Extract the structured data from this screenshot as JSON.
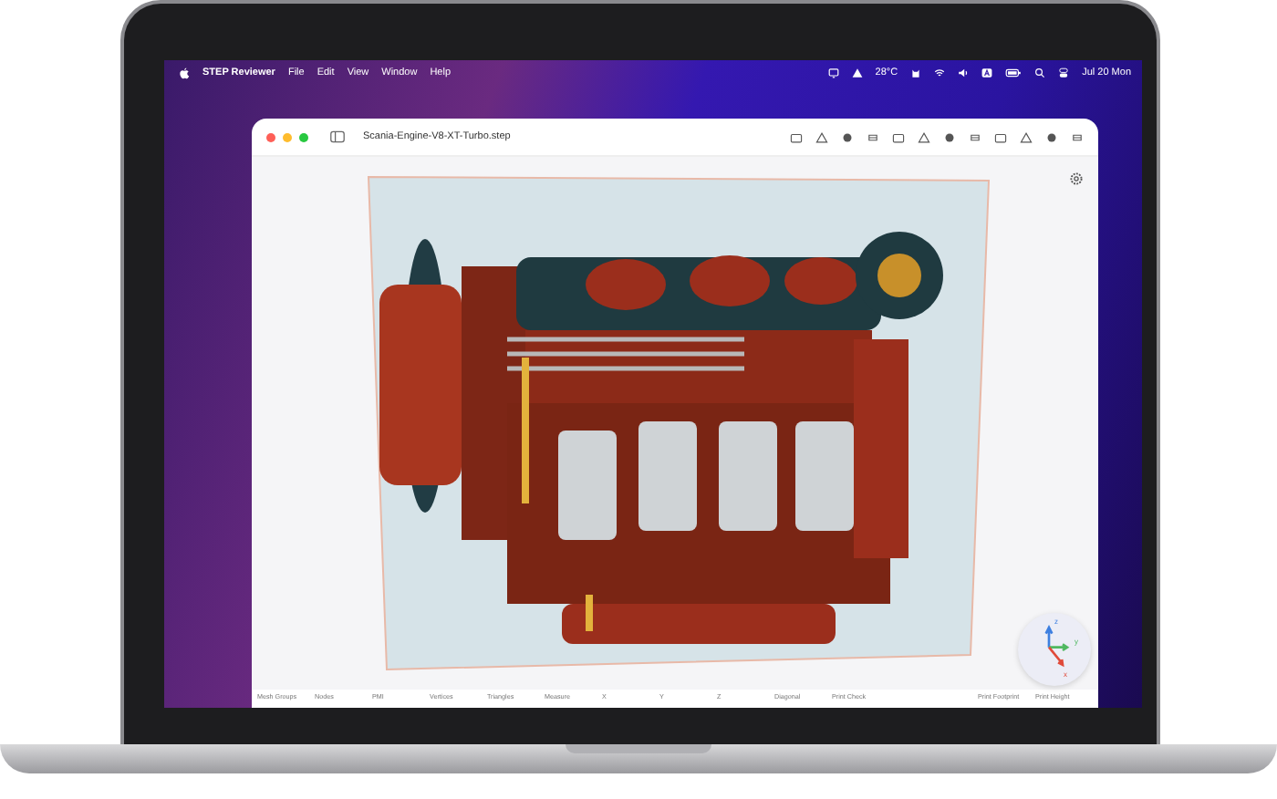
{
  "menu_bar": {
    "app_name": "STEP Reviewer",
    "menus": [
      "File",
      "Edit",
      "View",
      "Window",
      "Help"
    ],
    "weather": "28°C",
    "clock": "Jul 20 Mon"
  },
  "window": {
    "title": "Scania-Engine-V8-XT-Turbo.step"
  },
  "axis_gizmo": {
    "z_label": "z",
    "y_label": "y",
    "x_label": "x"
  },
  "status_bar": {
    "columns": [
      "Mesh Groups",
      "Nodes",
      "PMI",
      "Vertices",
      "Triangles",
      "Measure",
      "X",
      "Y",
      "Z",
      "Diagonal",
      "Print Check"
    ],
    "print_columns": [
      "Print Footprint",
      "Print Height"
    ]
  }
}
